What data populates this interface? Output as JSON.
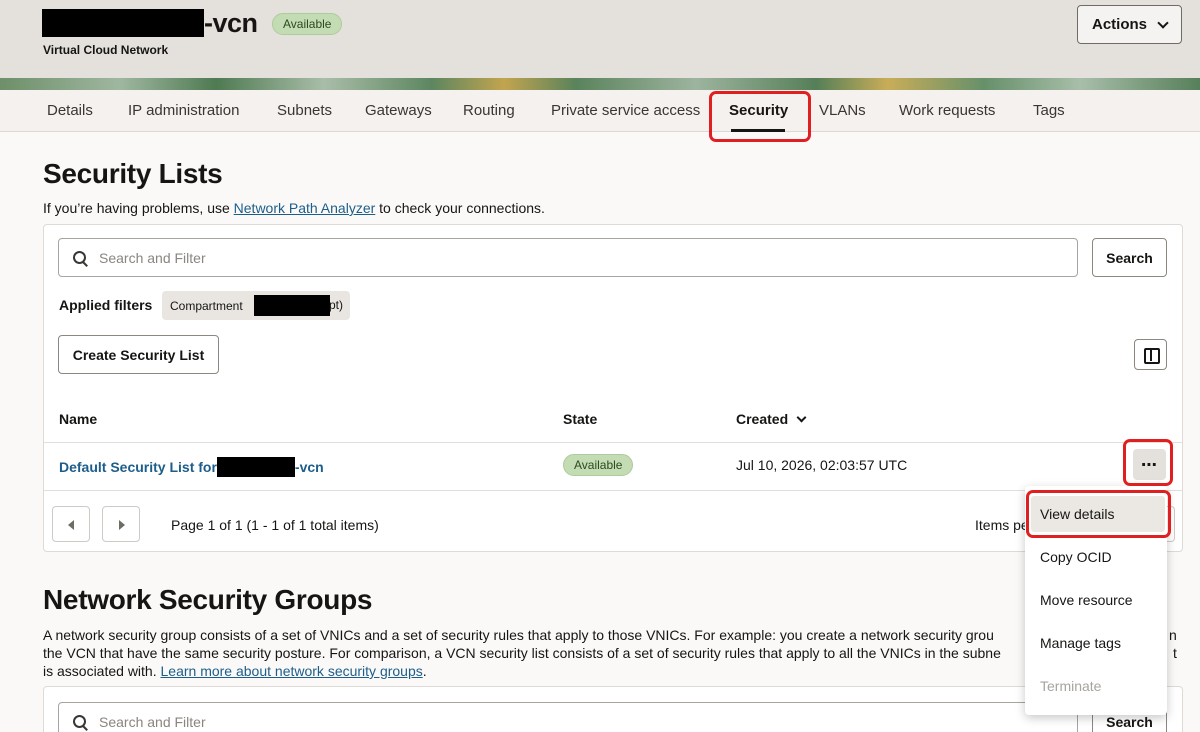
{
  "header": {
    "title_suffix": "-vcn",
    "status": "Available",
    "subtitle": "Virtual Cloud Network",
    "actions_label": "Actions"
  },
  "tabs": [
    {
      "label": "Details"
    },
    {
      "label": "IP administration"
    },
    {
      "label": "Subnets"
    },
    {
      "label": "Gateways"
    },
    {
      "label": "Routing"
    },
    {
      "label": "Private service access"
    },
    {
      "label": "Security"
    },
    {
      "label": "VLANs"
    },
    {
      "label": "Work requests"
    },
    {
      "label": "Tags"
    }
  ],
  "security_lists": {
    "title": "Security Lists",
    "intro_before": "If you’re having problems, use ",
    "intro_link": "Network Path Analyzer",
    "intro_after": " to check your connections.",
    "search_placeholder": "Search and Filter",
    "search_button": "Search",
    "applied_filters_label": "Applied filters",
    "filter_chip_prefix": "Compartment ",
    "filter_chip_tail": "pt)",
    "create_button": "Create Security List",
    "columns": {
      "name": "Name",
      "state": "State",
      "created": "Created"
    },
    "rows": [
      {
        "name_prefix": "Default Security List for",
        "name_suffix": "-vcn",
        "state": "Available",
        "created": "Jul 10, 2026, 02:03:57 UTC"
      }
    ],
    "pager_text": "Page 1 of 1 (1 - 1 of 1 total items)",
    "items_per_page_label": "Items pe"
  },
  "row_menu": {
    "items": [
      {
        "label": "View details"
      },
      {
        "label": "Copy OCID"
      },
      {
        "label": "Move resource"
      },
      {
        "label": "Manage tags"
      },
      {
        "label": "Terminate"
      }
    ]
  },
  "nsg": {
    "title": "Network Security Groups",
    "line1": "A network security group consists of a set of VNICs and a set of security rules that apply to those VNICs. For example: you create a network security grou",
    "line1_tail": "n",
    "line2": "the VCN that have the same security posture. For comparison, a VCN security list consists of a set of security rules that apply to all the VNICs in the subne",
    "line2_tail": "t",
    "line3_before": "is associated with. ",
    "line3_link": "Learn more about network security groups",
    "line3_after": ".",
    "search_placeholder": "Search and Filter",
    "search_button": "Search"
  }
}
